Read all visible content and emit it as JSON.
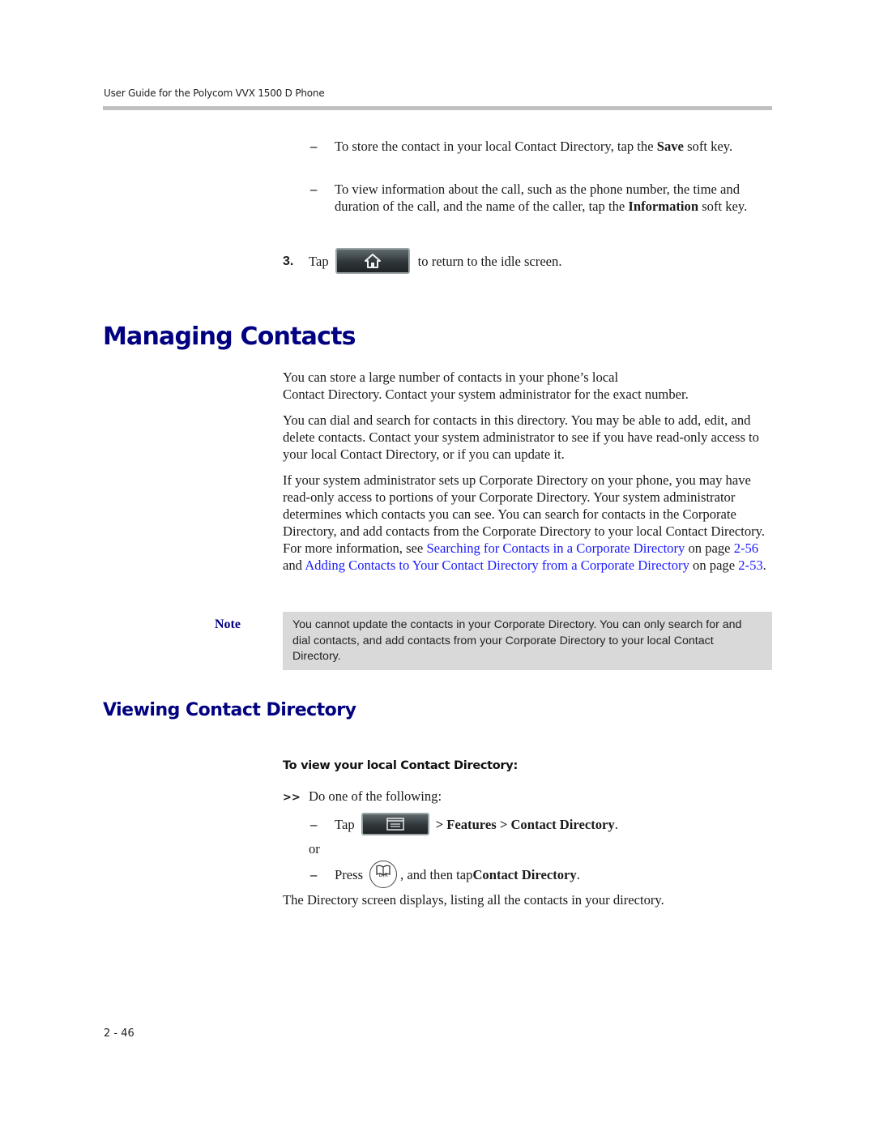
{
  "header": {
    "running_title": "User Guide for the Polycom VVX 1500 D Phone"
  },
  "steps_top": {
    "dash_items": [
      {
        "pre": "To store the contact in your local Contact Directory, tap the ",
        "bold": "Save",
        "post": " soft key."
      },
      {
        "pre": "To view information about the call, such as the phone number, the time and duration of the call, and the name of the caller, tap the ",
        "bold": "Information",
        "post": " soft key."
      }
    ],
    "step3": {
      "number": "3.",
      "pre": "Tap",
      "icon": "home-icon",
      "post": "to return to the idle screen."
    }
  },
  "section": {
    "title": "Managing Contacts",
    "paragraphs": [
      "You can store a large number of contacts in your phone’s local",
      "Contact Directory. Contact your system administrator for the exact number.",
      "You can dial and search for contacts in this directory. You may be able to add, edit, and delete contacts. Contact your system administrator to see if you have read-only access to your local Contact Directory, or if you can update it.",
      "If your system administrator sets up Corporate Directory on your phone, you may have read-only access to portions of your Corporate Directory. Your system administrator determines which contacts you can see. You can search for contacts in the Corporate Directory, and add contacts from the Corporate Directory to your local Contact Directory. For more information, see"
    ],
    "xref": {
      "link1": "Searching for Contacts in a Corporate Directory",
      "on_page_1": " on page ",
      "page1": "2-56",
      "and": " and ",
      "link2": "Adding Contacts to Your Contact Directory from a Corporate Directory",
      "on_page_2": " on page ",
      "page2": "2-53",
      "end": "."
    },
    "note": {
      "label": "Note",
      "text": "You cannot update the contacts in your Corporate Directory. You can only search for and dial contacts, and add contacts from your Corporate Directory to your local Contact Directory."
    }
  },
  "subsection": {
    "title": "Viewing Contact Directory",
    "procedure_title": "To view your local Contact Directory:",
    "lead_marker": ">>",
    "lead_text": "Do one of the following:",
    "option1": {
      "pre": "Tap",
      "icon": "menu-icon",
      "path": "> Features > Contact Directory",
      "end": "."
    },
    "or": "or",
    "option2": {
      "pre": "Press",
      "icon": "directory-key-icon",
      "key_label": "DIR",
      "mid": ", and then tap ",
      "bold": "Contact Directory",
      "end": "."
    },
    "result": "The Directory screen displays, listing all the contacts in your directory."
  },
  "footer": {
    "page_number": "2 - 46"
  }
}
